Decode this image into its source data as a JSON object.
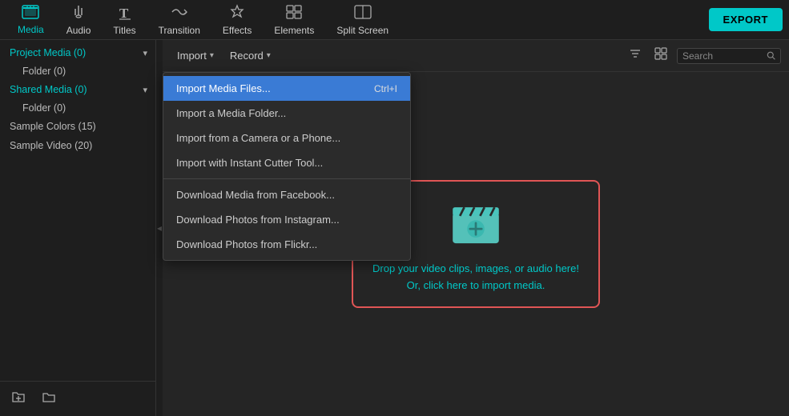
{
  "toolbar": {
    "export_label": "EXPORT",
    "items": [
      {
        "id": "media",
        "label": "Media",
        "icon": "🎞",
        "active": true
      },
      {
        "id": "audio",
        "label": "Audio",
        "icon": "♪"
      },
      {
        "id": "titles",
        "label": "Titles",
        "icon": "T"
      },
      {
        "id": "transition",
        "label": "Transition",
        "icon": "⇄"
      },
      {
        "id": "effects",
        "label": "Effects",
        "icon": "✦"
      },
      {
        "id": "elements",
        "label": "Elements",
        "icon": "▦"
      },
      {
        "id": "split_screen",
        "label": "Split Screen",
        "icon": "⧉"
      }
    ]
  },
  "sidebar": {
    "items": [
      {
        "id": "project_media",
        "label": "Project Media (0)",
        "has_arrow": true
      },
      {
        "id": "folder",
        "label": "Folder (0)",
        "indent": true
      },
      {
        "id": "shared_media",
        "label": "Shared Media (0)",
        "has_arrow": true
      },
      {
        "id": "shared_folder",
        "label": "Folder (0)",
        "indent": true
      },
      {
        "id": "sample_colors",
        "label": "Sample Colors (15)"
      },
      {
        "id": "sample_video",
        "label": "Sample Video (20)"
      }
    ],
    "footer": {
      "add_folder": "⊕",
      "add_item": "📁"
    }
  },
  "panel": {
    "import_label": "Import",
    "record_label": "Record",
    "search_placeholder": "Search"
  },
  "dropdown": {
    "items": [
      {
        "id": "import_media_files",
        "label": "Import Media Files...",
        "shortcut": "Ctrl+I",
        "highlighted": true
      },
      {
        "id": "import_media_folder",
        "label": "Import a Media Folder..."
      },
      {
        "id": "import_camera",
        "label": "Import from a Camera or a Phone..."
      },
      {
        "id": "import_instant_cutter",
        "label": "Import with Instant Cutter Tool..."
      },
      {
        "divider": true
      },
      {
        "id": "download_facebook",
        "label": "Download Media from Facebook..."
      },
      {
        "id": "download_instagram",
        "label": "Download Photos from Instagram..."
      },
      {
        "id": "download_flickr",
        "label": "Download Photos from Flickr..."
      }
    ]
  },
  "drop_area": {
    "line1": "Drop your video clips, images, or audio here!",
    "line2": "Or, click here to import media."
  }
}
